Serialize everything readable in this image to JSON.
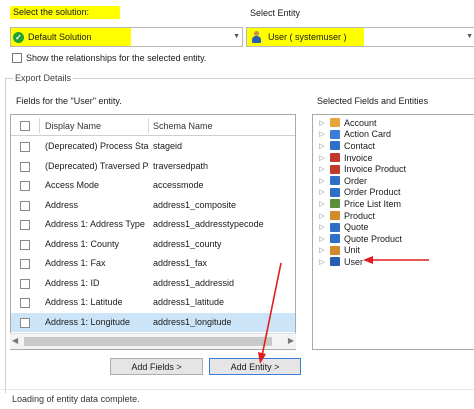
{
  "solution": {
    "label": "Select the solution:",
    "value": "Default Solution",
    "value_icon": "green-check-icon"
  },
  "entity": {
    "label": "Select Entity",
    "value": "User ( systemuser )",
    "value_icon": "user-icon"
  },
  "relationships": {
    "label": "Show the relationships for the selected entity.",
    "checked": false
  },
  "export": {
    "group_label": "Export Details",
    "fields_label": "Fields  for the \"User\" entity.",
    "selected_label": "Selected Fields and Entities",
    "columns": [
      "Display Name",
      "Schema Name"
    ],
    "rows": [
      {
        "display": "(Deprecated) Process Stag",
        "schema": "stageid"
      },
      {
        "display": "(Deprecated) Traversed Pa",
        "schema": "traversedpath"
      },
      {
        "display": "Access Mode",
        "schema": "accessmode"
      },
      {
        "display": "Address",
        "schema": "address1_composite"
      },
      {
        "display": "Address 1: Address Type",
        "schema": "address1_addresstypecode"
      },
      {
        "display": "Address 1: County",
        "schema": "address1_county"
      },
      {
        "display": "Address 1: Fax",
        "schema": "address1_fax"
      },
      {
        "display": "Address 1: ID",
        "schema": "address1_addressid"
      },
      {
        "display": "Address 1: Latitude",
        "schema": "address1_latitude"
      },
      {
        "display": "Address 1: Longitude",
        "schema": "address1_longitude"
      }
    ],
    "selected_row_index": 9,
    "tree": [
      {
        "label": "Account",
        "color": "#e8a33a"
      },
      {
        "label": "Action Card",
        "color": "#3b7dd8"
      },
      {
        "label": "Contact",
        "color": "#2f6fc7"
      },
      {
        "label": "Invoice",
        "color": "#c0392b"
      },
      {
        "label": "Invoice Product",
        "color": "#c0392b"
      },
      {
        "label": "Order",
        "color": "#2f6fc7"
      },
      {
        "label": "Order Product",
        "color": "#2f6fc7"
      },
      {
        "label": "Price List Item",
        "color": "#5a8f3c"
      },
      {
        "label": "Product",
        "color": "#d38a2a"
      },
      {
        "label": "Quote",
        "color": "#2f6fc7"
      },
      {
        "label": "Quote Product",
        "color": "#2f6fc7"
      },
      {
        "label": "Unit",
        "color": "#d38a2a"
      },
      {
        "label": "User",
        "color": "#2a5fb0"
      }
    ]
  },
  "buttons": {
    "add_fields": "Add Fields >",
    "add_entity": "Add Entity >"
  },
  "status": "Loading of entity data complete.",
  "colors": {
    "highlight": "#ffff00",
    "selection": "#cce4f7",
    "annotation_arrow": "#e21d1d"
  }
}
